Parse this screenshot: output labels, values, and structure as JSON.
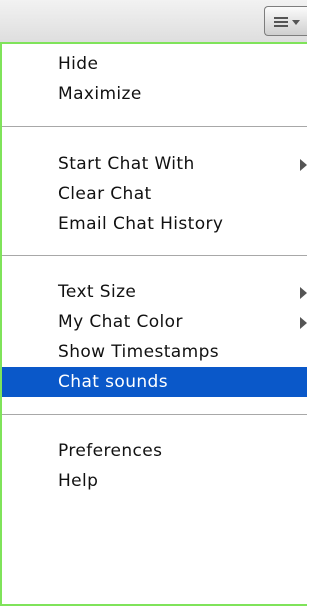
{
  "header": {
    "menu_icon": "hamburger-menu-icon"
  },
  "menu": {
    "hide": "Hide",
    "maximize": "Maximize",
    "start_chat_with": "Start Chat With",
    "clear_chat": "Clear Chat",
    "email_chat_history": "Email Chat History",
    "text_size": "Text Size",
    "my_chat_color": "My Chat Color",
    "show_timestamps": "Show Timestamps",
    "chat_sounds": "Chat sounds",
    "preferences": "Preferences",
    "help": "Help"
  },
  "colors": {
    "highlight": "#0a58c9",
    "menu_border": "#7fe35a"
  }
}
